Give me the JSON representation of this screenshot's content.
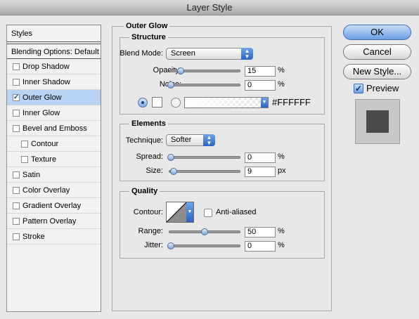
{
  "window": {
    "title": "Layer Style"
  },
  "stylelist": {
    "header": "Styles",
    "blending": "Blending Options: Default",
    "items": [
      {
        "label": "Drop Shadow",
        "checked": false,
        "indent": false
      },
      {
        "label": "Inner Shadow",
        "checked": false,
        "indent": false
      },
      {
        "label": "Outer Glow",
        "checked": true,
        "indent": false,
        "selected": true
      },
      {
        "label": "Inner Glow",
        "checked": false,
        "indent": false
      },
      {
        "label": "Bevel and Emboss",
        "checked": false,
        "indent": false
      },
      {
        "label": "Contour",
        "checked": false,
        "indent": true
      },
      {
        "label": "Texture",
        "checked": false,
        "indent": true
      },
      {
        "label": "Satin",
        "checked": false,
        "indent": false
      },
      {
        "label": "Color Overlay",
        "checked": false,
        "indent": false
      },
      {
        "label": "Gradient Overlay",
        "checked": false,
        "indent": false
      },
      {
        "label": "Pattern Overlay",
        "checked": false,
        "indent": false
      },
      {
        "label": "Stroke",
        "checked": false,
        "indent": false
      }
    ]
  },
  "outer_glow": {
    "title": "Outer Glow",
    "structure": {
      "title": "Structure",
      "blend_mode_label": "Blend Mode:",
      "blend_mode_value": "Screen",
      "opacity_label": "Opacity:",
      "opacity_value": "15",
      "opacity_unit": "%",
      "opacity_fraction": 0.15,
      "noise_label": "Noise:",
      "noise_value": "0",
      "noise_unit": "%",
      "noise_fraction": 0.0,
      "color_hex": "#FFFFFF"
    },
    "elements": {
      "title": "Elements",
      "technique_label": "Technique:",
      "technique_value": "Softer",
      "spread_label": "Spread:",
      "spread_value": "0",
      "spread_unit": "%",
      "spread_fraction": 0.0,
      "size_label": "Size:",
      "size_value": "9",
      "size_unit": "px",
      "size_fraction": 0.04
    },
    "quality": {
      "title": "Quality",
      "contour_label": "Contour:",
      "anti_aliased_label": "Anti-aliased",
      "anti_aliased_checked": false,
      "range_label": "Range:",
      "range_value": "50",
      "range_unit": "%",
      "range_fraction": 0.5,
      "jitter_label": "Jitter:",
      "jitter_value": "0",
      "jitter_unit": "%",
      "jitter_fraction": 0.0
    }
  },
  "buttons": {
    "ok": "OK",
    "cancel": "Cancel",
    "new_style": "New Style...",
    "preview_label": "Preview",
    "preview_checked": true
  },
  "colors": {
    "accent": "#2a63c6",
    "selection": "#b9d3f5",
    "preview_swatch": "#4a4a4a",
    "glow_color": "#FFFFFF"
  },
  "icons": [
    "check-icon",
    "popup-arrow-icon",
    "radio-icon",
    "color-swatch-icon",
    "gradient-icon",
    "contour-curve-icon"
  ]
}
